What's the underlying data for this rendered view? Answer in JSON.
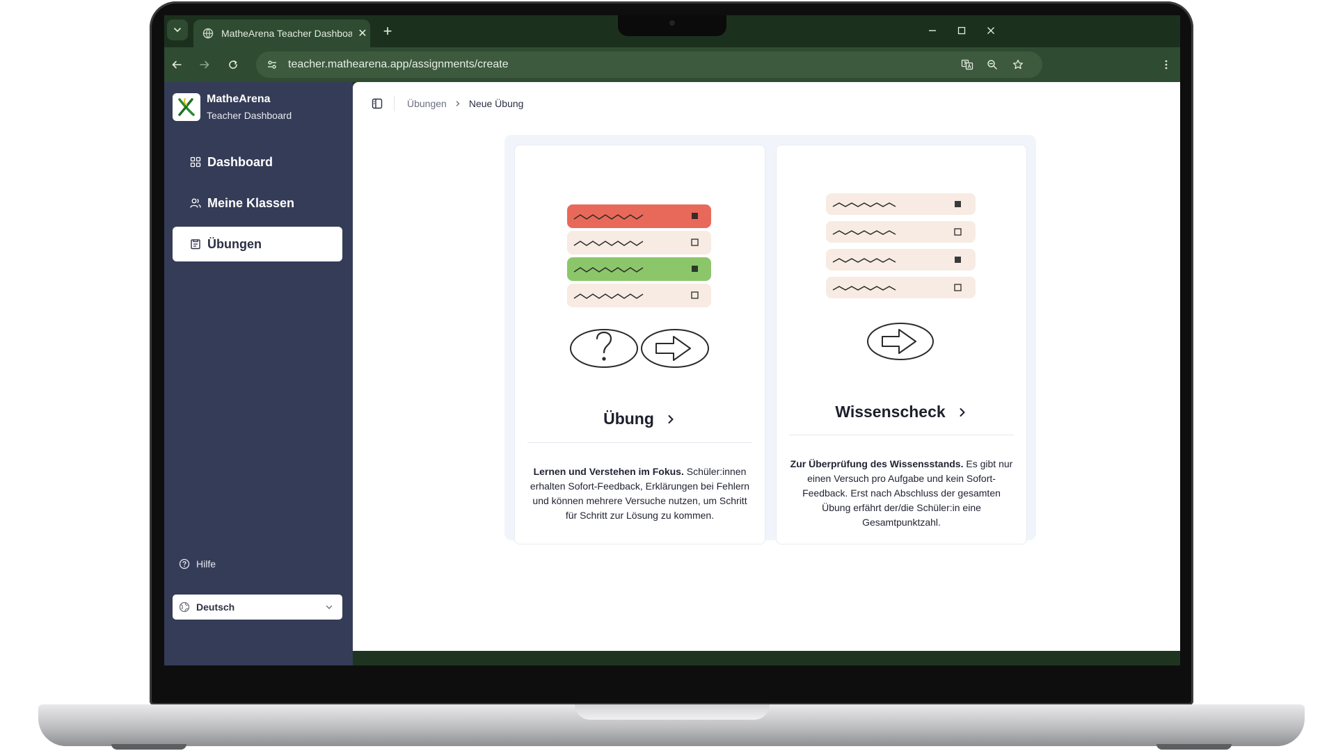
{
  "browser": {
    "tab_title": "MatheArena Teacher Dashboard",
    "url": "teacher.mathearena.app/assignments/create"
  },
  "app": {
    "name": "MatheArena",
    "subtitle": "Teacher Dashboard"
  },
  "sidebar": {
    "items": [
      {
        "label": "Dashboard",
        "icon": "grid-icon"
      },
      {
        "label": "Meine Klassen",
        "icon": "users-icon"
      },
      {
        "label": "Übungen",
        "icon": "clipboard-icon",
        "active": true
      }
    ],
    "help_label": "Hilfe",
    "language": "Deutsch"
  },
  "breadcrumb": {
    "parent": "Übungen",
    "current": "Neue Übung"
  },
  "cards": [
    {
      "title": "Übung",
      "desc_bold": "Lernen und Verstehen im Fokus.",
      "desc_rest": "Schüler:innen erhalten Sofort-Feedback, Erklärungen bei Fehlern und können mehrere Versuche nutzen, um Schritt für Schritt zur Lösung zu kommen."
    },
    {
      "title": "Wissenscheck",
      "desc_bold": "Zur Überprüfung des Wissensstands.",
      "desc_rest": "Es gibt nur einen Versuch pro Aufgabe und kein Sofort-Feedback. Erst nach Abschluss der gesamten Übung erfährt der/die Schüler:in eine Gesamtpunktzahl."
    }
  ],
  "colors": {
    "sidebar": "#353c57",
    "browser_chrome": "#2f4b31",
    "wrong_answer": "#e8695a",
    "right_answer": "#8cc66a",
    "answer_bg": "#f7ebe3"
  }
}
